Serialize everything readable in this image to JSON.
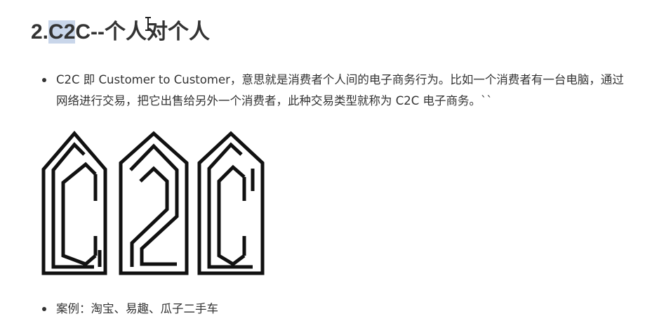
{
  "heading": {
    "prefix": "2.",
    "selected": "C2",
    "suffix": "C--个人对个人"
  },
  "bullets": [
    {
      "text": "C2C 即 Customer to Customer，意思就是消费者个人间的电子商务行为。比如一个消费者有一台电脑，通过网络进行交易，把它出售给另外一个消费者，此种交易类型就称为 C2C 电子商务。``"
    },
    {
      "text": "案例：淘宝、易趣、瓜子二手车"
    }
  ],
  "logo": {
    "icon": "c2c-logo-icon",
    "color": "#111111"
  },
  "cursor": {
    "icon": "text-cursor-icon"
  }
}
